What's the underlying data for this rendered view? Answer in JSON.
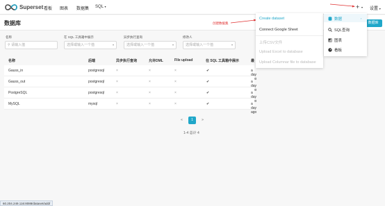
{
  "navbar": {
    "brand": "Superset",
    "items": [
      "看板",
      "图表",
      "数据集",
      "SQL"
    ],
    "sql_caret": "▾",
    "plus": "+",
    "plus_caret": "▾",
    "settings": "设置",
    "settings_caret": "▾"
  },
  "page": {
    "title": "数据库",
    "add_button": "+ 数据库"
  },
  "filters": [
    {
      "label": "名称",
      "placeholder": "请输入值"
    },
    {
      "label": "在 SQL 工具箱中展示",
      "placeholder": "选择或输入一个值"
    },
    {
      "label": "异步执行查询",
      "placeholder": "选择或输入一个值"
    },
    {
      "label": "修改人",
      "placeholder": "选择或输入一个值"
    }
  ],
  "table": {
    "headers": [
      "名称",
      "后端",
      "异步执行查询",
      "允许DML",
      "File upload",
      "在 SQL 工具箱中展示",
      "最"
    ],
    "rows": [
      {
        "name": "Gauss_in",
        "backend": "postgresql",
        "async": "×",
        "dml": "×",
        "upload": "×",
        "sql_lab": "✔",
        "modified": "a day ago"
      },
      {
        "name": "Gauss_out",
        "backend": "postgresql",
        "async": "×",
        "dml": "×",
        "upload": "×",
        "sql_lab": "✔",
        "modified": "a day ago"
      },
      {
        "name": "PostgreSQL",
        "backend": "postgresql",
        "async": "×",
        "dml": "×",
        "upload": "×",
        "sql_lab": "✔",
        "modified": "a day ago"
      },
      {
        "name": "MySQL",
        "backend": "mysql",
        "async": "×",
        "dml": "×",
        "upload": "×",
        "sql_lab": "✔",
        "modified": "a day ago"
      }
    ]
  },
  "pagination": {
    "prev": "«",
    "current": "1",
    "next": "»",
    "summary": "1-4 总计 4"
  },
  "dropdown": {
    "items": [
      {
        "label": "Create dataset",
        "state": "primary"
      },
      {
        "label": "Connect Google Sheet",
        "state": "normal"
      },
      {
        "label": "上传CSV文件",
        "state": "disabled"
      },
      {
        "label": "Upload Excel to database",
        "state": "disabled"
      },
      {
        "label": "Upload Columnar file to database",
        "state": "disabled"
      }
    ]
  },
  "submenu": {
    "items": [
      {
        "label": "数据",
        "icon": "database-icon"
      },
      {
        "label": "SQL查询",
        "icon": "search-icon"
      },
      {
        "label": "图表",
        "icon": "chart-icon"
      },
      {
        "label": "看板",
        "icon": "dashboard-icon"
      }
    ],
    "arrow": "›"
  },
  "annotation": {
    "text": "创建数据集",
    "color": "#e03131"
  },
  "statusbar": {
    "url": "60.204.249.116:8088/dataset/add/"
  },
  "colors": {
    "accent": "#20a7c9"
  }
}
